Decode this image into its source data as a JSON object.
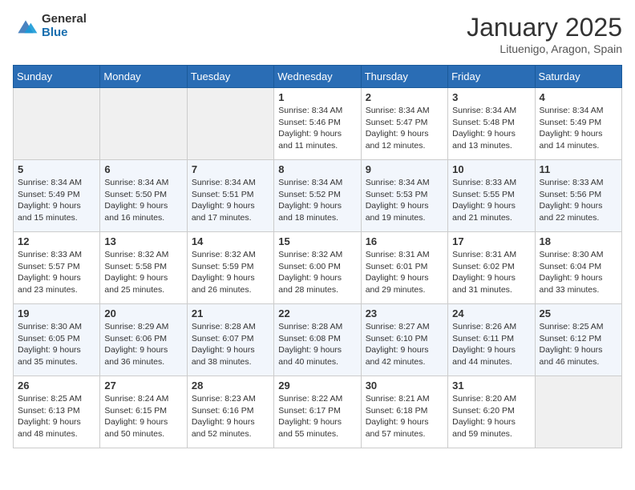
{
  "logo": {
    "general": "General",
    "blue": "Blue"
  },
  "title": "January 2025",
  "location": "Lituenigo, Aragon, Spain",
  "days_of_week": [
    "Sunday",
    "Monday",
    "Tuesday",
    "Wednesday",
    "Thursday",
    "Friday",
    "Saturday"
  ],
  "weeks": [
    [
      {
        "day": "",
        "info": ""
      },
      {
        "day": "",
        "info": ""
      },
      {
        "day": "",
        "info": ""
      },
      {
        "day": "1",
        "info": "Sunrise: 8:34 AM\nSunset: 5:46 PM\nDaylight: 9 hours\nand 11 minutes."
      },
      {
        "day": "2",
        "info": "Sunrise: 8:34 AM\nSunset: 5:47 PM\nDaylight: 9 hours\nand 12 minutes."
      },
      {
        "day": "3",
        "info": "Sunrise: 8:34 AM\nSunset: 5:48 PM\nDaylight: 9 hours\nand 13 minutes."
      },
      {
        "day": "4",
        "info": "Sunrise: 8:34 AM\nSunset: 5:49 PM\nDaylight: 9 hours\nand 14 minutes."
      }
    ],
    [
      {
        "day": "5",
        "info": "Sunrise: 8:34 AM\nSunset: 5:49 PM\nDaylight: 9 hours\nand 15 minutes."
      },
      {
        "day": "6",
        "info": "Sunrise: 8:34 AM\nSunset: 5:50 PM\nDaylight: 9 hours\nand 16 minutes."
      },
      {
        "day": "7",
        "info": "Sunrise: 8:34 AM\nSunset: 5:51 PM\nDaylight: 9 hours\nand 17 minutes."
      },
      {
        "day": "8",
        "info": "Sunrise: 8:34 AM\nSunset: 5:52 PM\nDaylight: 9 hours\nand 18 minutes."
      },
      {
        "day": "9",
        "info": "Sunrise: 8:34 AM\nSunset: 5:53 PM\nDaylight: 9 hours\nand 19 minutes."
      },
      {
        "day": "10",
        "info": "Sunrise: 8:33 AM\nSunset: 5:55 PM\nDaylight: 9 hours\nand 21 minutes."
      },
      {
        "day": "11",
        "info": "Sunrise: 8:33 AM\nSunset: 5:56 PM\nDaylight: 9 hours\nand 22 minutes."
      }
    ],
    [
      {
        "day": "12",
        "info": "Sunrise: 8:33 AM\nSunset: 5:57 PM\nDaylight: 9 hours\nand 23 minutes."
      },
      {
        "day": "13",
        "info": "Sunrise: 8:32 AM\nSunset: 5:58 PM\nDaylight: 9 hours\nand 25 minutes."
      },
      {
        "day": "14",
        "info": "Sunrise: 8:32 AM\nSunset: 5:59 PM\nDaylight: 9 hours\nand 26 minutes."
      },
      {
        "day": "15",
        "info": "Sunrise: 8:32 AM\nSunset: 6:00 PM\nDaylight: 9 hours\nand 28 minutes."
      },
      {
        "day": "16",
        "info": "Sunrise: 8:31 AM\nSunset: 6:01 PM\nDaylight: 9 hours\nand 29 minutes."
      },
      {
        "day": "17",
        "info": "Sunrise: 8:31 AM\nSunset: 6:02 PM\nDaylight: 9 hours\nand 31 minutes."
      },
      {
        "day": "18",
        "info": "Sunrise: 8:30 AM\nSunset: 6:04 PM\nDaylight: 9 hours\nand 33 minutes."
      }
    ],
    [
      {
        "day": "19",
        "info": "Sunrise: 8:30 AM\nSunset: 6:05 PM\nDaylight: 9 hours\nand 35 minutes."
      },
      {
        "day": "20",
        "info": "Sunrise: 8:29 AM\nSunset: 6:06 PM\nDaylight: 9 hours\nand 36 minutes."
      },
      {
        "day": "21",
        "info": "Sunrise: 8:28 AM\nSunset: 6:07 PM\nDaylight: 9 hours\nand 38 minutes."
      },
      {
        "day": "22",
        "info": "Sunrise: 8:28 AM\nSunset: 6:08 PM\nDaylight: 9 hours\nand 40 minutes."
      },
      {
        "day": "23",
        "info": "Sunrise: 8:27 AM\nSunset: 6:10 PM\nDaylight: 9 hours\nand 42 minutes."
      },
      {
        "day": "24",
        "info": "Sunrise: 8:26 AM\nSunset: 6:11 PM\nDaylight: 9 hours\nand 44 minutes."
      },
      {
        "day": "25",
        "info": "Sunrise: 8:25 AM\nSunset: 6:12 PM\nDaylight: 9 hours\nand 46 minutes."
      }
    ],
    [
      {
        "day": "26",
        "info": "Sunrise: 8:25 AM\nSunset: 6:13 PM\nDaylight: 9 hours\nand 48 minutes."
      },
      {
        "day": "27",
        "info": "Sunrise: 8:24 AM\nSunset: 6:15 PM\nDaylight: 9 hours\nand 50 minutes."
      },
      {
        "day": "28",
        "info": "Sunrise: 8:23 AM\nSunset: 6:16 PM\nDaylight: 9 hours\nand 52 minutes."
      },
      {
        "day": "29",
        "info": "Sunrise: 8:22 AM\nSunset: 6:17 PM\nDaylight: 9 hours\nand 55 minutes."
      },
      {
        "day": "30",
        "info": "Sunrise: 8:21 AM\nSunset: 6:18 PM\nDaylight: 9 hours\nand 57 minutes."
      },
      {
        "day": "31",
        "info": "Sunrise: 8:20 AM\nSunset: 6:20 PM\nDaylight: 9 hours\nand 59 minutes."
      },
      {
        "day": "",
        "info": ""
      }
    ]
  ]
}
